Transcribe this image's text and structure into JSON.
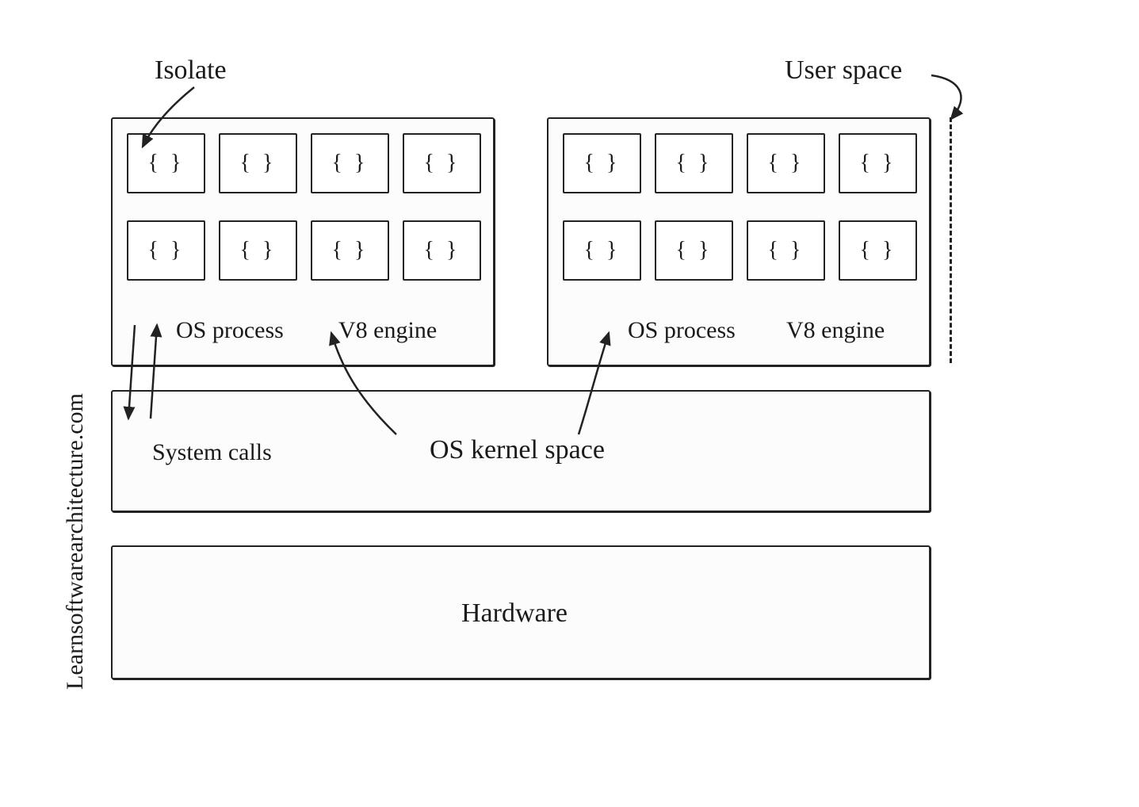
{
  "title_labels": {
    "isolate": "Isolate",
    "user_space": "User space",
    "system_calls": "System calls",
    "os_kernel": "OS kernel space",
    "hardware": "Hardware",
    "os_process": "OS process",
    "v8_engine": "V8 engine",
    "watermark": "Learnsoftwarearchitecture.com"
  },
  "isolate_glyph": "{ }",
  "layout": {
    "process_boxes": 2,
    "isolates_per_process": 8,
    "isolate_rows": 2,
    "isolate_cols": 4
  },
  "diagram": {
    "description": "Architecture diagram showing Isolates inside V8 engine OS processes running in user space, above the OS kernel space layer (connected via system calls), above the hardware layer.",
    "layers": [
      {
        "name": "User space",
        "contains": [
          {
            "type": "OS process (V8 engine)",
            "count": 2,
            "each_contains": {
              "type": "Isolate",
              "count": 8
            }
          }
        ]
      },
      {
        "name": "OS kernel space",
        "connects_to_user_space_via": "System calls"
      },
      {
        "name": "Hardware"
      }
    ]
  }
}
